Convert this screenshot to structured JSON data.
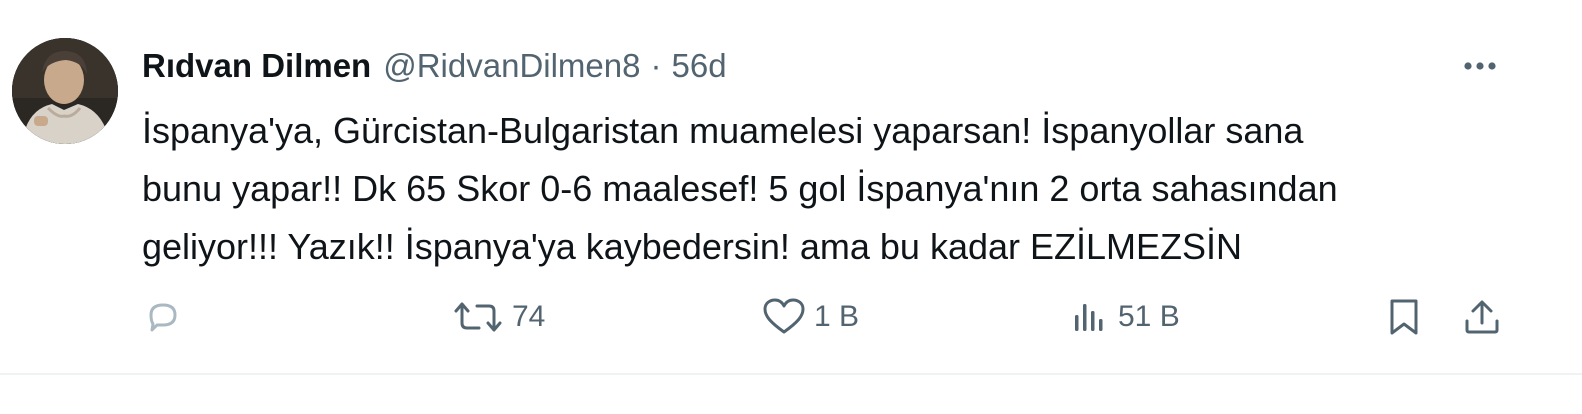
{
  "author": {
    "display_name": "Rıdvan Dilmen",
    "handle": "@RidvanDilmen8",
    "separator": "·",
    "time": "56d"
  },
  "tweet": {
    "lines": [
      "İspanya'ya, Gürcistan-Bulgaristan muamelesi yaparsan! İspanyollar sana",
      "bunu yapar!! Dk 65 Skor 0-6 maalesef! 5 gol İspanya'nın 2 orta sahasından",
      "geliyor!!! Yazık!! İspanya'ya kaybedersin! ama bu kadar EZİLMEZSİN"
    ]
  },
  "actions": {
    "reply": {
      "icon": "reply-icon",
      "count": ""
    },
    "retweet": {
      "icon": "retweet-icon",
      "count": "74"
    },
    "like": {
      "icon": "heart-icon",
      "count": "1 B"
    },
    "views": {
      "icon": "views-icon",
      "count": "51 B"
    },
    "bookmark": {
      "icon": "bookmark-icon"
    },
    "share": {
      "icon": "share-icon"
    }
  },
  "menu": {
    "icon": "more-icon"
  },
  "colors": {
    "text": "#0f1419",
    "muted": "#536471",
    "reply_icon": "#aab8c2",
    "divider": "#eff3f4",
    "background": "#ffffff"
  }
}
